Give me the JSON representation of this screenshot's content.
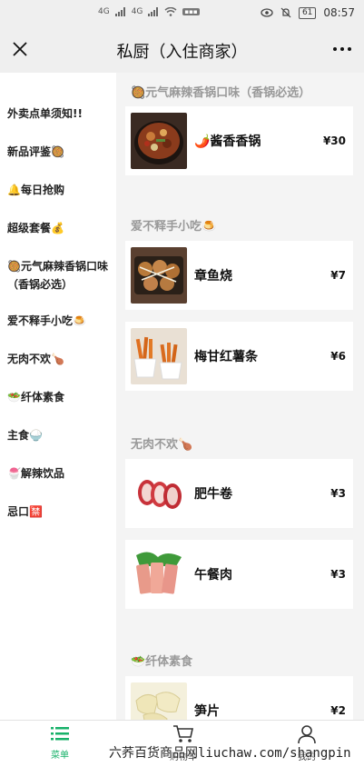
{
  "status": {
    "signal_left": "4G",
    "signal_right": "4G",
    "battery": "61",
    "time": "08:57"
  },
  "header": {
    "title": "私厨（入住商家）"
  },
  "sidebar": {
    "items": [
      {
        "label": "外卖点单须知!!"
      },
      {
        "label": "新品评鉴🥘"
      },
      {
        "label": "🔔每日抢购"
      },
      {
        "label": "超级套餐💰"
      },
      {
        "label": "🥘元气麻辣香锅口味（香锅必选）"
      },
      {
        "label": "爱不释手小吃🍮"
      },
      {
        "label": "无肉不欢🍗"
      },
      {
        "label": "🥗纤体素食"
      },
      {
        "label": "主食🍚"
      },
      {
        "label": "🍧解辣饮品"
      },
      {
        "label": "忌口🈲"
      }
    ]
  },
  "sections": [
    {
      "title": "🥘元气麻辣香锅口味（香锅必选）",
      "dishes": [
        {
          "name": "🌶️酱香香锅",
          "price": "¥30",
          "image": "spicy-hotpot-photo"
        }
      ]
    },
    {
      "title": "爱不释手小吃🍮",
      "dishes": [
        {
          "name": "章鱼烧",
          "price": "¥7",
          "image": "takoyaki-photo"
        },
        {
          "name": "梅甘红薯条",
          "price": "¥6",
          "image": "sweet-potato-fries-photo"
        }
      ]
    },
    {
      "title": "无肉不欢🍗",
      "dishes": [
        {
          "name": "肥牛卷",
          "price": "¥3",
          "image": "beef-rolls-photo"
        },
        {
          "name": "午餐肉",
          "price": "¥3",
          "image": "luncheon-meat-photo"
        }
      ]
    },
    {
      "title": "🥗纤体素食",
      "dishes": [
        {
          "name": "笋片",
          "price": "¥2",
          "image": "bamboo-shoots-photo"
        }
      ]
    }
  ],
  "tabbar": {
    "tabs": [
      {
        "label": "菜单",
        "icon": "menu-list-icon",
        "active": true
      },
      {
        "label": "购物车",
        "icon": "cart-icon",
        "active": false
      },
      {
        "label": "我的",
        "icon": "user-icon",
        "active": false
      }
    ]
  },
  "watermark": "六荞百货商品网liuchaw.com/shangpin",
  "colors": {
    "accent": "#17b169",
    "section_title": "#999999",
    "background": "#f4f4f4"
  }
}
